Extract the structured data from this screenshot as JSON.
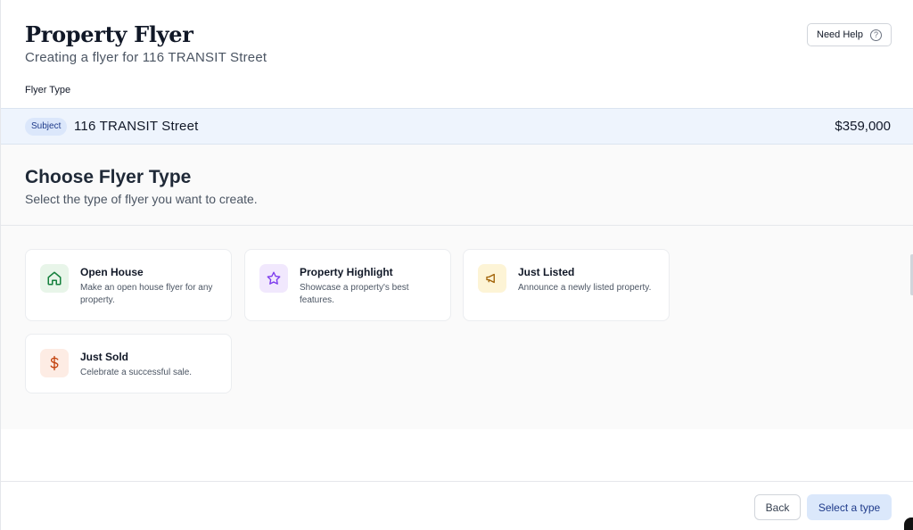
{
  "header": {
    "title": "Property Flyer",
    "subtitle": "Creating a flyer for 116 TRANSIT Street",
    "help_label": "Need Help",
    "help_icon": "question-circle-icon"
  },
  "flyer_type_label": "Flyer Type",
  "subject": {
    "badge": "Subject",
    "address": "116 TRANSIT Street",
    "price": "$359,000"
  },
  "choose": {
    "title": "Choose Flyer Type",
    "subtitle": "Select the type of flyer you want to create."
  },
  "flyer_types": [
    {
      "title": "Open House",
      "description": "Make an open house flyer for any property.",
      "icon": "house-icon",
      "icon_color": "#15803d",
      "icon_bg": "#e8f5e9"
    },
    {
      "title": "Property Highlight",
      "description": "Showcase a property's best features.",
      "icon": "star-icon",
      "icon_color": "#7c3aed",
      "icon_bg": "#f1e8fd"
    },
    {
      "title": "Just Listed",
      "description": "Announce a newly listed property.",
      "icon": "megaphone-icon",
      "icon_color": "#a16207",
      "icon_bg": "#fdf4d6"
    },
    {
      "title": "Just Sold",
      "description": "Celebrate a successful sale.",
      "icon": "dollar-icon",
      "icon_color": "#c2410c",
      "icon_bg": "#fdece4"
    }
  ],
  "footer": {
    "back_label": "Back",
    "select_label": "Select a type"
  }
}
